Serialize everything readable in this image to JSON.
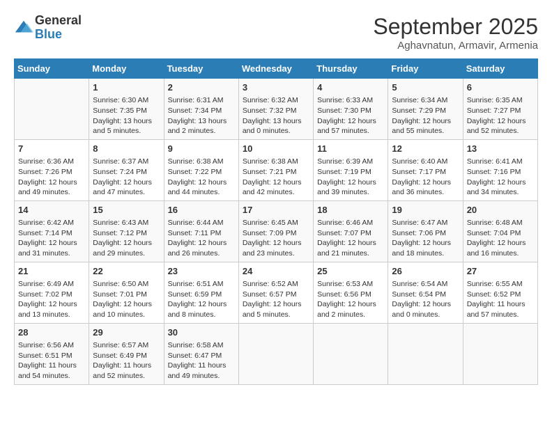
{
  "logo": {
    "general": "General",
    "blue": "Blue"
  },
  "title": "September 2025",
  "location": "Aghavnatun, Armavir, Armenia",
  "headers": [
    "Sunday",
    "Monday",
    "Tuesday",
    "Wednesday",
    "Thursday",
    "Friday",
    "Saturday"
  ],
  "weeks": [
    [
      {
        "day": "",
        "info": ""
      },
      {
        "day": "1",
        "info": "Sunrise: 6:30 AM\nSunset: 7:35 PM\nDaylight: 13 hours\nand 5 minutes."
      },
      {
        "day": "2",
        "info": "Sunrise: 6:31 AM\nSunset: 7:34 PM\nDaylight: 13 hours\nand 2 minutes."
      },
      {
        "day": "3",
        "info": "Sunrise: 6:32 AM\nSunset: 7:32 PM\nDaylight: 13 hours\nand 0 minutes."
      },
      {
        "day": "4",
        "info": "Sunrise: 6:33 AM\nSunset: 7:30 PM\nDaylight: 12 hours\nand 57 minutes."
      },
      {
        "day": "5",
        "info": "Sunrise: 6:34 AM\nSunset: 7:29 PM\nDaylight: 12 hours\nand 55 minutes."
      },
      {
        "day": "6",
        "info": "Sunrise: 6:35 AM\nSunset: 7:27 PM\nDaylight: 12 hours\nand 52 minutes."
      }
    ],
    [
      {
        "day": "7",
        "info": "Sunrise: 6:36 AM\nSunset: 7:26 PM\nDaylight: 12 hours\nand 49 minutes."
      },
      {
        "day": "8",
        "info": "Sunrise: 6:37 AM\nSunset: 7:24 PM\nDaylight: 12 hours\nand 47 minutes."
      },
      {
        "day": "9",
        "info": "Sunrise: 6:38 AM\nSunset: 7:22 PM\nDaylight: 12 hours\nand 44 minutes."
      },
      {
        "day": "10",
        "info": "Sunrise: 6:38 AM\nSunset: 7:21 PM\nDaylight: 12 hours\nand 42 minutes."
      },
      {
        "day": "11",
        "info": "Sunrise: 6:39 AM\nSunset: 7:19 PM\nDaylight: 12 hours\nand 39 minutes."
      },
      {
        "day": "12",
        "info": "Sunrise: 6:40 AM\nSunset: 7:17 PM\nDaylight: 12 hours\nand 36 minutes."
      },
      {
        "day": "13",
        "info": "Sunrise: 6:41 AM\nSunset: 7:16 PM\nDaylight: 12 hours\nand 34 minutes."
      }
    ],
    [
      {
        "day": "14",
        "info": "Sunrise: 6:42 AM\nSunset: 7:14 PM\nDaylight: 12 hours\nand 31 minutes."
      },
      {
        "day": "15",
        "info": "Sunrise: 6:43 AM\nSunset: 7:12 PM\nDaylight: 12 hours\nand 29 minutes."
      },
      {
        "day": "16",
        "info": "Sunrise: 6:44 AM\nSunset: 7:11 PM\nDaylight: 12 hours\nand 26 minutes."
      },
      {
        "day": "17",
        "info": "Sunrise: 6:45 AM\nSunset: 7:09 PM\nDaylight: 12 hours\nand 23 minutes."
      },
      {
        "day": "18",
        "info": "Sunrise: 6:46 AM\nSunset: 7:07 PM\nDaylight: 12 hours\nand 21 minutes."
      },
      {
        "day": "19",
        "info": "Sunrise: 6:47 AM\nSunset: 7:06 PM\nDaylight: 12 hours\nand 18 minutes."
      },
      {
        "day": "20",
        "info": "Sunrise: 6:48 AM\nSunset: 7:04 PM\nDaylight: 12 hours\nand 16 minutes."
      }
    ],
    [
      {
        "day": "21",
        "info": "Sunrise: 6:49 AM\nSunset: 7:02 PM\nDaylight: 12 hours\nand 13 minutes."
      },
      {
        "day": "22",
        "info": "Sunrise: 6:50 AM\nSunset: 7:01 PM\nDaylight: 12 hours\nand 10 minutes."
      },
      {
        "day": "23",
        "info": "Sunrise: 6:51 AM\nSunset: 6:59 PM\nDaylight: 12 hours\nand 8 minutes."
      },
      {
        "day": "24",
        "info": "Sunrise: 6:52 AM\nSunset: 6:57 PM\nDaylight: 12 hours\nand 5 minutes."
      },
      {
        "day": "25",
        "info": "Sunrise: 6:53 AM\nSunset: 6:56 PM\nDaylight: 12 hours\nand 2 minutes."
      },
      {
        "day": "26",
        "info": "Sunrise: 6:54 AM\nSunset: 6:54 PM\nDaylight: 12 hours\nand 0 minutes."
      },
      {
        "day": "27",
        "info": "Sunrise: 6:55 AM\nSunset: 6:52 PM\nDaylight: 11 hours\nand 57 minutes."
      }
    ],
    [
      {
        "day": "28",
        "info": "Sunrise: 6:56 AM\nSunset: 6:51 PM\nDaylight: 11 hours\nand 54 minutes."
      },
      {
        "day": "29",
        "info": "Sunrise: 6:57 AM\nSunset: 6:49 PM\nDaylight: 11 hours\nand 52 minutes."
      },
      {
        "day": "30",
        "info": "Sunrise: 6:58 AM\nSunset: 6:47 PM\nDaylight: 11 hours\nand 49 minutes."
      },
      {
        "day": "",
        "info": ""
      },
      {
        "day": "",
        "info": ""
      },
      {
        "day": "",
        "info": ""
      },
      {
        "day": "",
        "info": ""
      }
    ]
  ]
}
